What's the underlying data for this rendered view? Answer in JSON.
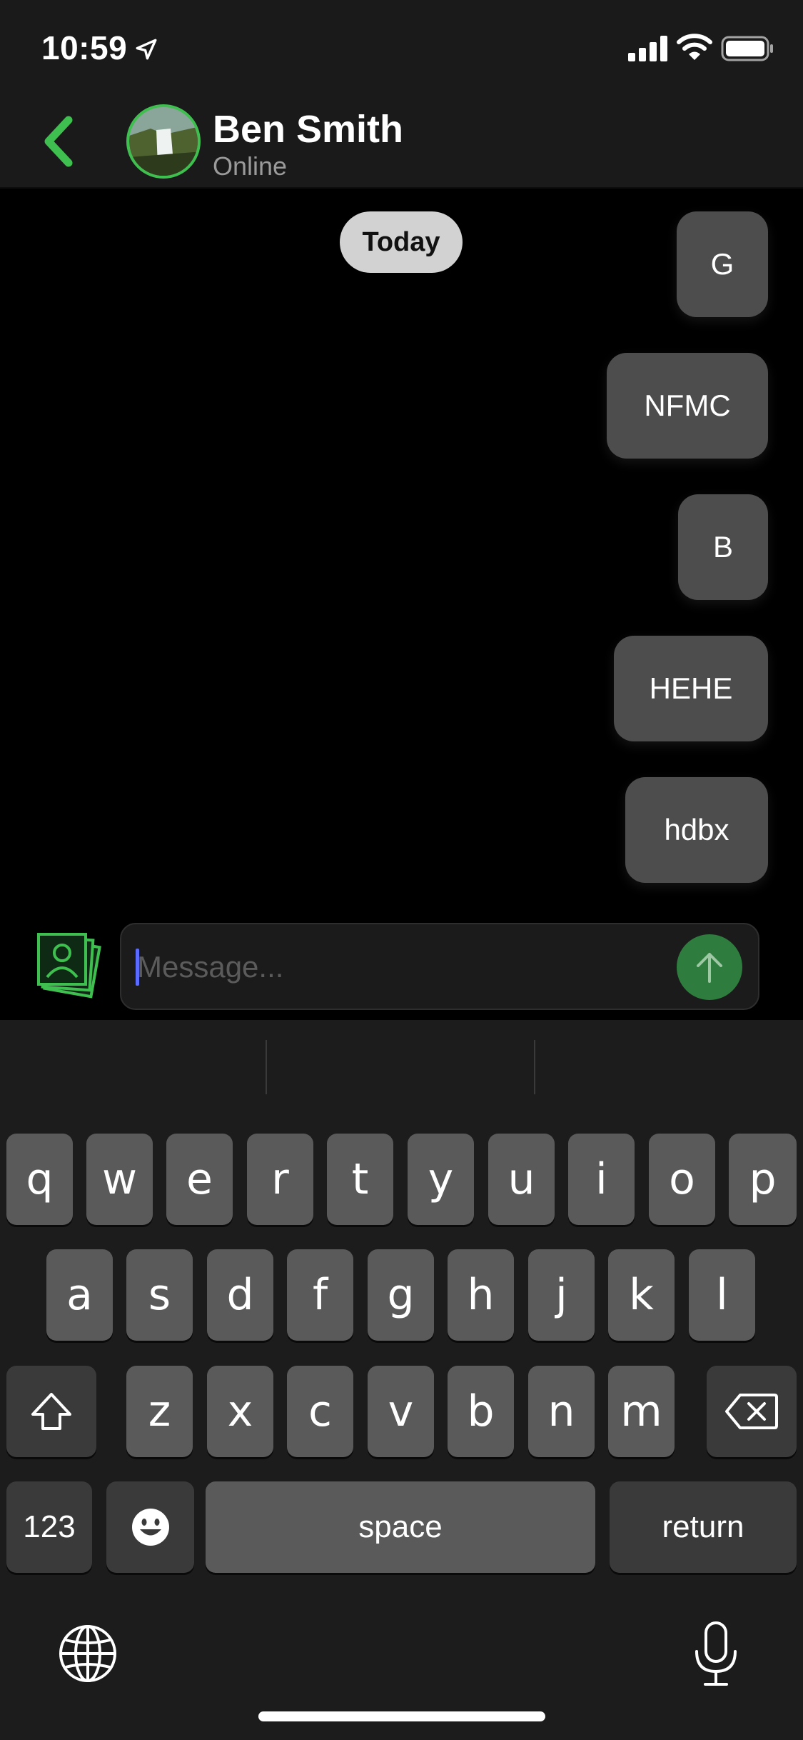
{
  "status_bar": {
    "time": "10:59"
  },
  "header": {
    "back_label": "Back",
    "contact_name": "Ben Smith",
    "contact_status": "Online"
  },
  "chat": {
    "date_label": "Today",
    "messages": [
      {
        "text": "G"
      },
      {
        "text": "NFMC"
      },
      {
        "text": "B"
      },
      {
        "text": "HEHE"
      },
      {
        "text": "hdbx"
      }
    ]
  },
  "composer": {
    "placeholder": "Message...",
    "value": ""
  },
  "keyboard": {
    "row1": [
      "q",
      "w",
      "e",
      "r",
      "t",
      "y",
      "u",
      "i",
      "o",
      "p"
    ],
    "row2": [
      "a",
      "s",
      "d",
      "f",
      "g",
      "h",
      "j",
      "k",
      "l"
    ],
    "row3": [
      "z",
      "x",
      "c",
      "v",
      "b",
      "n",
      "m"
    ],
    "numbers_label": "123",
    "space_label": "space",
    "return_label": "return"
  },
  "colors": {
    "accent": "#3fbf4f",
    "send": "#2e7d3e",
    "bubble": "#4d4d4d"
  },
  "icons": [
    "location-arrow-icon",
    "signal-icon",
    "wifi-icon",
    "battery-icon",
    "chevron-left-icon",
    "photos-icon",
    "arrow-up-icon",
    "shift-icon",
    "backspace-icon",
    "emoji-icon",
    "globe-icon",
    "microphone-icon"
  ]
}
